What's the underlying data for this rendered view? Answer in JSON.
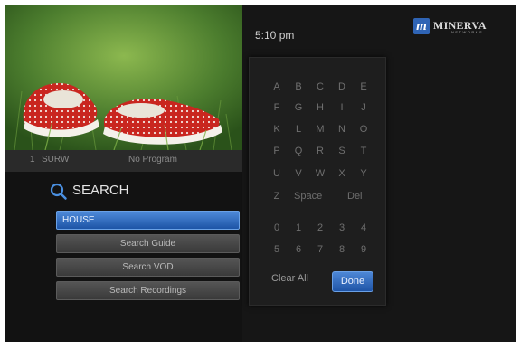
{
  "time": "5:10 pm",
  "logo": {
    "mark": "m",
    "name": "MINERVA",
    "sub": "NETWORKS"
  },
  "channel": {
    "number": "1",
    "name": "SURW",
    "program": "No Program"
  },
  "search": {
    "heading": "SEARCH"
  },
  "results": [
    {
      "label": "HOUSE"
    },
    {
      "label": "Search Guide"
    },
    {
      "label": "Search VOD"
    },
    {
      "label": "Search Recordings"
    }
  ],
  "keyboard": {
    "rows": [
      [
        "A",
        "B",
        "C",
        "D",
        "E"
      ],
      [
        "F",
        "G",
        "H",
        "I",
        "J"
      ],
      [
        "K",
        "L",
        "M",
        "N",
        "O"
      ],
      [
        "P",
        "Q",
        "R",
        "S",
        "T"
      ],
      [
        "U",
        "V",
        "W",
        "X",
        "Y"
      ]
    ],
    "z": "Z",
    "space": "Space",
    "del": "Del",
    "digits_row1": [
      "0",
      "1",
      "2",
      "3",
      "4"
    ],
    "digits_row2": [
      "5",
      "6",
      "7",
      "8",
      "9"
    ],
    "clear_all": "Clear All",
    "done": "Done"
  },
  "colors": {
    "accent": "#2f64b5",
    "background": "#121212"
  }
}
